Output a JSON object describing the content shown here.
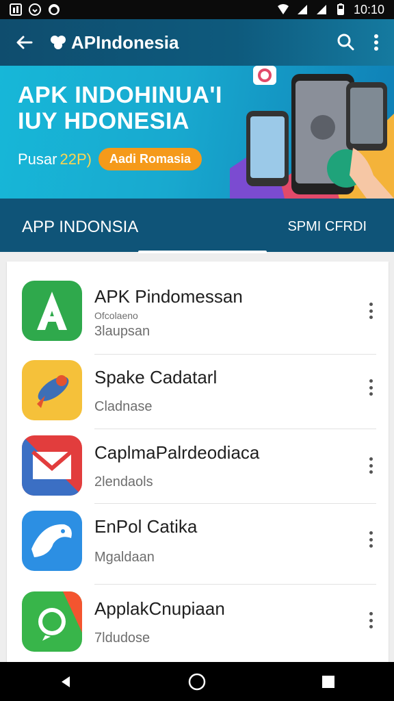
{
  "statusbar": {
    "time": "10:10",
    "icons": [
      "notification-icon",
      "download-icon",
      "app-icon",
      "wifi-icon",
      "signal-icon",
      "signal-icon",
      "battery-icon"
    ]
  },
  "appbar": {
    "title": "APIndonesia",
    "icons": [
      "back-arrow-icon",
      "logo-icon",
      "search-icon",
      "more-vert-icon"
    ]
  },
  "banner": {
    "headline_line1": "APK INDOHINUA'I",
    "headline_line2": "IUY HDONESIA",
    "pusar": "Pusar",
    "year": "22P)",
    "pill": "Aadi Romasia"
  },
  "tabs": [
    {
      "label": "APP INDONSIA"
    },
    {
      "label": "SPMI CFRDI"
    }
  ],
  "items": [
    {
      "name": "APK Pindomessan",
      "sub_small": "Ofcolaeno",
      "sub": "3laupsan",
      "icon": "app-icon-green-a"
    },
    {
      "name": "Spake Cadatarl",
      "sub_small": "",
      "sub": "Cladnase",
      "icon": "app-icon-rocket"
    },
    {
      "name": "CaplmaPalrdeodiaca",
      "sub_small": "",
      "sub": "2lendaols",
      "icon": "app-icon-red-envelope"
    },
    {
      "name": "EnPol Catika",
      "sub_small": "",
      "sub": "Mgaldaan",
      "icon": "app-icon-blue-bird"
    },
    {
      "name": "ApplakCnupiaan",
      "sub_small": "",
      "sub": "7ldudose",
      "icon": "app-icon-whatsapp"
    }
  ],
  "colors": {
    "appbar": "#0e5a7d",
    "banner": "#17b7d8",
    "tabs": "#0f5478",
    "accent": "#f59a1a"
  }
}
